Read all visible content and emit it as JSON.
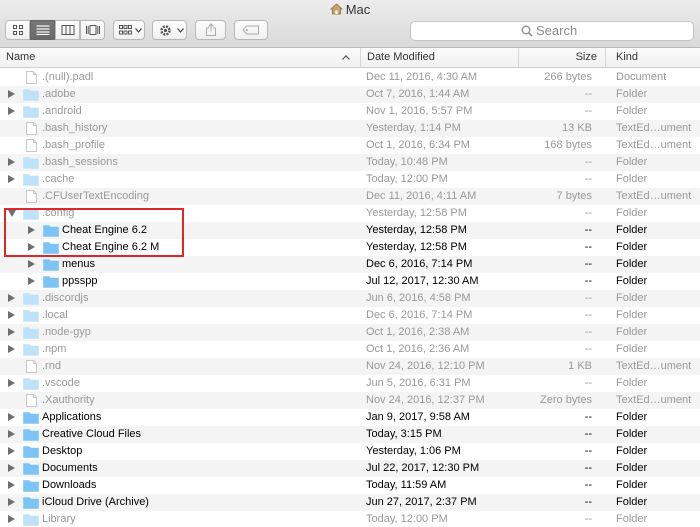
{
  "window": {
    "title": "Mac"
  },
  "search": {
    "placeholder": "Search"
  },
  "columns": {
    "name": "Name",
    "date": "Date Modified",
    "size": "Size",
    "kind": "Kind"
  },
  "colors": {
    "folder": "#7bc4f5",
    "folder_dim": "#bfe2fb",
    "highlight": "#e0262a"
  },
  "files": [
    {
      "name": ".(null).padl",
      "date": "Dec 11, 2016, 4:30 AM",
      "size": "266 bytes",
      "kind": "Document",
      "type": "doc",
      "indent": 0,
      "expand": "none",
      "dim": true
    },
    {
      "name": ".adobe",
      "date": "Oct 7, 2016, 1:44 AM",
      "size": "--",
      "kind": "Folder",
      "type": "folder",
      "indent": 0,
      "expand": "closed",
      "dim": true
    },
    {
      "name": ".android",
      "date": "Nov 1, 2016, 5:57 PM",
      "size": "--",
      "kind": "Folder",
      "type": "folder",
      "indent": 0,
      "expand": "closed",
      "dim": true
    },
    {
      "name": ".bash_history",
      "date": "Yesterday, 1:14 PM",
      "size": "13 KB",
      "kind": "TextEd…ument",
      "type": "doc",
      "indent": 0,
      "expand": "none",
      "dim": true
    },
    {
      "name": ".bash_profile",
      "date": "Oct 1, 2016, 6:34 PM",
      "size": "168 bytes",
      "kind": "TextEd…ument",
      "type": "doc",
      "indent": 0,
      "expand": "none",
      "dim": true
    },
    {
      "name": ".bash_sessions",
      "date": "Today, 10:48 PM",
      "size": "--",
      "kind": "Folder",
      "type": "folder",
      "indent": 0,
      "expand": "closed",
      "dim": true
    },
    {
      "name": ".cache",
      "date": "Today, 12:00 PM",
      "size": "--",
      "kind": "Folder",
      "type": "folder",
      "indent": 0,
      "expand": "closed",
      "dim": true
    },
    {
      "name": ".CFUserTextEncoding",
      "date": "Dec 11, 2016, 4:11 AM",
      "size": "7 bytes",
      "kind": "TextEd…ument",
      "type": "doc",
      "indent": 0,
      "expand": "none",
      "dim": true
    },
    {
      "name": ".config",
      "date": "Yesterday, 12:58 PM",
      "size": "--",
      "kind": "Folder",
      "type": "folder",
      "indent": 0,
      "expand": "open",
      "dim": true
    },
    {
      "name": "Cheat Engine 6.2",
      "date": "Yesterday, 12:58 PM",
      "size": "--",
      "kind": "Folder",
      "type": "folder",
      "indent": 1,
      "expand": "closed",
      "dim": false
    },
    {
      "name": "Cheat Engine 6.2 M",
      "date": "Yesterday, 12:58 PM",
      "size": "--",
      "kind": "Folder",
      "type": "folder",
      "indent": 1,
      "expand": "closed",
      "dim": false
    },
    {
      "name": "menus",
      "date": "Dec 6, 2016, 7:14 PM",
      "size": "--",
      "kind": "Folder",
      "type": "folder",
      "indent": 1,
      "expand": "closed",
      "dim": false
    },
    {
      "name": "ppsspp",
      "date": "Jul 12, 2017, 12:30 AM",
      "size": "--",
      "kind": "Folder",
      "type": "folder",
      "indent": 1,
      "expand": "closed",
      "dim": false
    },
    {
      "name": ".discordjs",
      "date": "Jun 6, 2016, 4:58 PM",
      "size": "--",
      "kind": "Folder",
      "type": "folder",
      "indent": 0,
      "expand": "closed",
      "dim": true
    },
    {
      "name": ".local",
      "date": "Dec 6, 2016, 7:14 PM",
      "size": "--",
      "kind": "Folder",
      "type": "folder",
      "indent": 0,
      "expand": "closed",
      "dim": true
    },
    {
      "name": ".node-gyp",
      "date": "Oct 1, 2016, 2:38 AM",
      "size": "--",
      "kind": "Folder",
      "type": "folder",
      "indent": 0,
      "expand": "closed",
      "dim": true
    },
    {
      "name": ".npm",
      "date": "Oct 1, 2016, 2:36 AM",
      "size": "--",
      "kind": "Folder",
      "type": "folder",
      "indent": 0,
      "expand": "closed",
      "dim": true
    },
    {
      "name": ".rnd",
      "date": "Nov 24, 2016, 12:10 PM",
      "size": "1 KB",
      "kind": "TextEd…ument",
      "type": "doc",
      "indent": 0,
      "expand": "none",
      "dim": true
    },
    {
      "name": ".vscode",
      "date": "Jun 5, 2016, 6:31 PM",
      "size": "--",
      "kind": "Folder",
      "type": "folder",
      "indent": 0,
      "expand": "closed",
      "dim": true
    },
    {
      "name": ".Xauthority",
      "date": "Nov 24, 2016, 12:37 PM",
      "size": "Zero bytes",
      "kind": "TextEd…ument",
      "type": "doc",
      "indent": 0,
      "expand": "none",
      "dim": true
    },
    {
      "name": "Applications",
      "date": "Jan 9, 2017, 9:58 AM",
      "size": "--",
      "kind": "Folder",
      "type": "folder",
      "indent": 0,
      "expand": "closed",
      "dim": false
    },
    {
      "name": "Creative Cloud Files",
      "date": "Today, 3:15 PM",
      "size": "--",
      "kind": "Folder",
      "type": "folder",
      "indent": 0,
      "expand": "closed",
      "dim": false
    },
    {
      "name": "Desktop",
      "date": "Yesterday, 1:06 PM",
      "size": "--",
      "kind": "Folder",
      "type": "folder",
      "indent": 0,
      "expand": "closed",
      "dim": false
    },
    {
      "name": "Documents",
      "date": "Jul 22, 2017, 12:30 PM",
      "size": "--",
      "kind": "Folder",
      "type": "folder",
      "indent": 0,
      "expand": "closed",
      "dim": false
    },
    {
      "name": "Downloads",
      "date": "Today, 11:59 AM",
      "size": "--",
      "kind": "Folder",
      "type": "folder",
      "indent": 0,
      "expand": "closed",
      "dim": false
    },
    {
      "name": "iCloud Drive (Archive)",
      "date": "Jun 27, 2017, 2:37 PM",
      "size": "--",
      "kind": "Folder",
      "type": "folder",
      "indent": 0,
      "expand": "closed",
      "dim": false
    },
    {
      "name": "Library",
      "date": "Today, 12:00 PM",
      "size": "--",
      "kind": "Folder",
      "type": "folder",
      "indent": 0,
      "expand": "closed",
      "dim": true
    }
  ]
}
